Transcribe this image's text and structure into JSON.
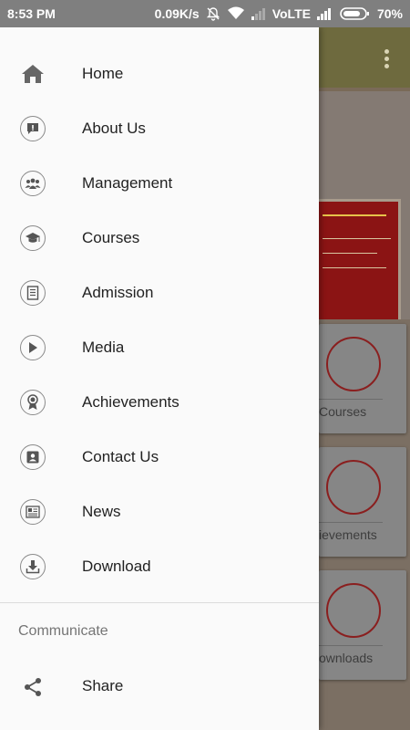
{
  "status_bar": {
    "time": "8:53 PM",
    "network_speed": "0.09K/s",
    "volte": "VoLTE",
    "battery": "70%"
  },
  "drawer": {
    "items": [
      {
        "label": "Home",
        "icon": "home-icon"
      },
      {
        "label": "About Us",
        "icon": "about-icon"
      },
      {
        "label": "Management",
        "icon": "group-icon"
      },
      {
        "label": "Courses",
        "icon": "graduation-cap-icon"
      },
      {
        "label": "Admission",
        "icon": "admission-form-icon"
      },
      {
        "label": "Media",
        "icon": "play-icon"
      },
      {
        "label": "Achievements",
        "icon": "award-icon"
      },
      {
        "label": "Contact Us",
        "icon": "contact-icon"
      },
      {
        "label": "News",
        "icon": "newspaper-icon"
      },
      {
        "label": "Download",
        "icon": "download-icon"
      }
    ],
    "section_label": "Communicate",
    "communicate_items": [
      {
        "label": "Share",
        "icon": "share-icon"
      }
    ]
  },
  "background_app": {
    "cards": [
      {
        "label": "Courses",
        "icon": "graduation-cap-icon"
      },
      {
        "label": "ievements",
        "icon": "award-icon"
      },
      {
        "label": "ownloads",
        "icon": "download-icon"
      }
    ]
  },
  "colors": {
    "drawer_bg": "#fafafa",
    "icon_gray": "#666666",
    "scrim": "#6b6b6b",
    "accent_red": "#8a1f1f"
  }
}
